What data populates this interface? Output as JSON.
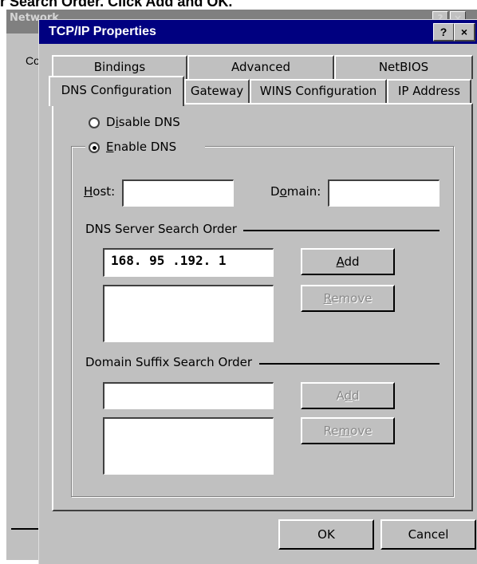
{
  "caption": "r Search Order. Click Add and OK.",
  "network_window": {
    "title": "Network",
    "help_glyph": "?",
    "close_glyph": "×",
    "peek_text": "Co"
  },
  "dialog": {
    "title": "TCP/IP Properties",
    "help_glyph": "?",
    "close_glyph": "×"
  },
  "tabs": {
    "row1": [
      "Bindings",
      "Advanced",
      "NetBIOS"
    ],
    "row2": [
      "DNS Configuration",
      "Gateway",
      "WINS Configuration",
      "IP Address"
    ],
    "selected": "DNS Configuration"
  },
  "dns": {
    "disable_label_pre": "D",
    "disable_label_u": "i",
    "disable_label_post": "sable DNS",
    "enable_label_u": "E",
    "enable_label_post": "nable DNS",
    "selected": "Enable DNS",
    "host_label_u": "H",
    "host_label_post": "ost:",
    "host_value": "",
    "domain_label_pre": "D",
    "domain_label_u": "o",
    "domain_label_post": "main:",
    "domain_value": ""
  },
  "server_order": {
    "label": "DNS Server Search Order",
    "input_value": "168. 95 .192.  1",
    "add_u": "A",
    "add_post": "dd",
    "remove_u": "R",
    "remove_post": "emove",
    "list": []
  },
  "suffix_order": {
    "label": "Domain Suffix Search Order",
    "input_value": "",
    "add_pre": "A",
    "add_u": "d",
    "add_post": "d",
    "remove_pre": "Re",
    "remove_u": "m",
    "remove_post": "ove",
    "list": []
  },
  "footer": {
    "ok_label": "OK",
    "cancel_label": "Cancel"
  }
}
